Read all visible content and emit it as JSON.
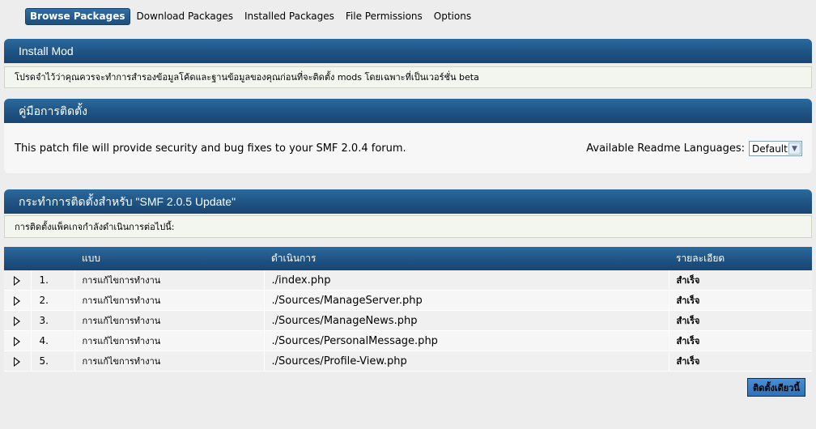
{
  "tabs": [
    {
      "label": "Browse Packages",
      "active": true
    },
    {
      "label": "Download Packages",
      "active": false
    },
    {
      "label": "Installed Packages",
      "active": false
    },
    {
      "label": "File Permissions",
      "active": false
    },
    {
      "label": "Options",
      "active": false
    }
  ],
  "install_mod": {
    "title": "Install Mod",
    "notice": "โปรดจำไว้ว่าคุณควรจะทำการสำรองข้อมูลโค้ดและฐานข้อมูลของคุณก่อนที่จะติดตั้ง mods โดยเฉพาะที่เป็นเวอร์ชั่น beta"
  },
  "readme": {
    "title": "คู่มือการติดตั้ง",
    "text": "This patch file will provide security and bug fixes to your SMF 2.0.4 forum.",
    "languages_label": "Available Readme Languages:",
    "language_selected": "Default"
  },
  "actions": {
    "title": "กระทำการติดตั้งสำหรับ \"SMF 2.0.5 Update\"",
    "notice": "การติดตั้งแพ็คเกจกำลังดำเนินการต่อไปนี้:",
    "columns": [
      "แบบ",
      "ดำเนินการ",
      "รายละเอียด"
    ],
    "rows": [
      {
        "num": "1.",
        "type": "การแก้ไขการทำงาน",
        "action": "./index.php",
        "detail": "สำเร็จ"
      },
      {
        "num": "2.",
        "type": "การแก้ไขการทำงาน",
        "action": "./Sources/ManageServer.php",
        "detail": "สำเร็จ"
      },
      {
        "num": "3.",
        "type": "การแก้ไขการทำงาน",
        "action": "./Sources/ManageNews.php",
        "detail": "สำเร็จ"
      },
      {
        "num": "4.",
        "type": "การแก้ไขการทำงาน",
        "action": "./Sources/PersonalMessage.php",
        "detail": "สำเร็จ"
      },
      {
        "num": "5.",
        "type": "การแก้ไขการทำงาน",
        "action": "./Sources/Profile-View.php",
        "detail": "สำเร็จ"
      }
    ],
    "install_button": "ติดตั้งเดียวนี้"
  }
}
